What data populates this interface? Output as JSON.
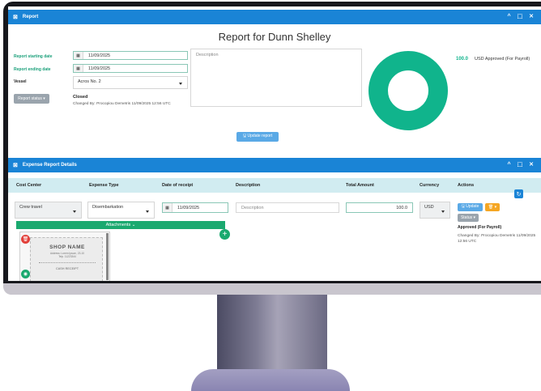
{
  "report_panel": {
    "header_icon": "expand-icon",
    "header_title": "Report",
    "window_controls": "^ ⬚ ✕",
    "title": "Report for Dunn Shelley",
    "start_label": "Report starting date",
    "start_value": "11/09/2025",
    "end_label": "Report ending date",
    "end_value": "11/09/2025",
    "vessel_label": "Vessel",
    "vessel_value": "Acros No. 2",
    "status_button": "Report status ▾",
    "status_value": "Closed",
    "changed_by": "Changed By: Procopiou Demetris 11/09/2025 12:56 UTC",
    "description_placeholder": "Description",
    "update_button": "🖫 Update report",
    "donut_color": "#10b48c",
    "summary_amount": "100.0",
    "summary_label": "USD Approved (For Payroll)"
  },
  "expense_panel": {
    "header_icon": "expand-icon",
    "header_title": "Expense Report Details",
    "window_controls": "^ ⬚ ✕",
    "columns": [
      "Cost Center",
      "Expense Type",
      "Date of receipt",
      "Description",
      "Total Amount",
      "Currency",
      "Actions"
    ],
    "row": {
      "cost_center": "Crew travel",
      "expense_type": "Disembarkation",
      "date": "11/09/2025",
      "description_placeholder": "Description",
      "amount": "100.0",
      "currency": "USD",
      "update_button": "🖫 Update",
      "delete_button": "🗑 ▾",
      "status_button": "Status ▾",
      "status_value": "Approved (For Payroll)",
      "changed_by": "Changed By: Procopiou Demetris 11/09/2025 12:56 UTC"
    },
    "attachments_label": "Attachments ⌄",
    "receipt": {
      "shop_name": "SHOP NAME",
      "address": "Address: Lorem Ipsum, 23-10\nTelp. 11223344",
      "cash_receipt": "CASH RECEIPT"
    }
  }
}
